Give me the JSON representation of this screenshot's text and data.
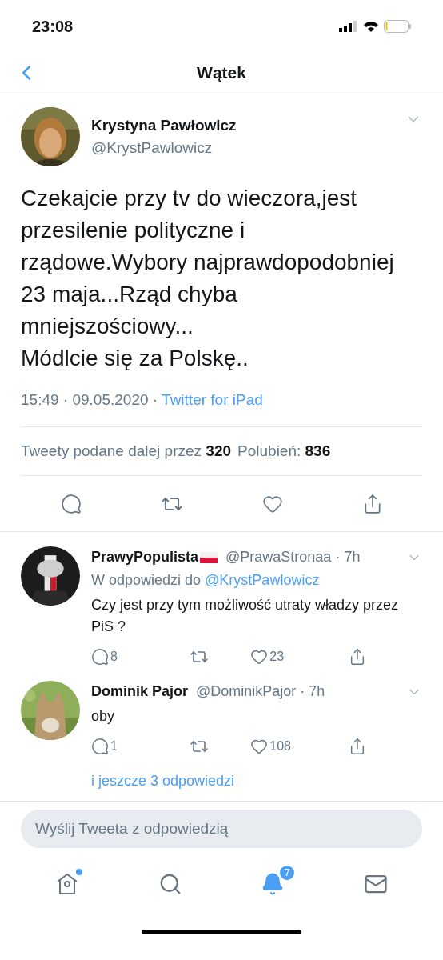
{
  "status_bar": {
    "time": "23:08"
  },
  "header": {
    "title": "Wątek"
  },
  "tweet": {
    "name": "Krystyna Pawłowicz",
    "handle": "@KrystPawlowicz",
    "text": "Czekajcie przy tv do wieczora,jest przesilenie polityczne i rządowe.Wybory najprawdopodobniej 23 maja...Rząd chyba mniejszościowy...\nMódlcie się za Polskę..",
    "time": "15:49 · 09.05.2020 · ",
    "source": "Twitter for iPad",
    "retweets_label": "Tweety podane dalej przez",
    "retweets": "320",
    "likes_label": "Polubień:",
    "likes": "836"
  },
  "replies": [
    {
      "name": "PrawyPopulista",
      "flag": true,
      "handle": "@PrawaStronaa · 7h",
      "reply_to_label": "W odpowiedzi do",
      "reply_to": "@KrystPawlowicz",
      "text": "Czy jest przy tym możliwość utraty władzy przez PiS ?",
      "comments": "8",
      "likes": "23"
    },
    {
      "name": "Dominik Pajor",
      "flag": false,
      "handle": "@DominikPajor · 7h",
      "text": "oby",
      "comments": "1",
      "likes": "108"
    }
  ],
  "more_replies": "i jeszcze 3 odpowiedzi",
  "reply_field": {
    "placeholder": "Wyślij Tweeta z odpowiedzią"
  },
  "tab_bar": [
    {
      "kind": "home",
      "selected": false,
      "dot": true
    },
    {
      "kind": "search",
      "selected": false,
      "dot": false
    },
    {
      "kind": "notifications",
      "selected": true,
      "dot": false,
      "badge": "7"
    },
    {
      "kind": "messages",
      "selected": false,
      "dot": false
    }
  ]
}
